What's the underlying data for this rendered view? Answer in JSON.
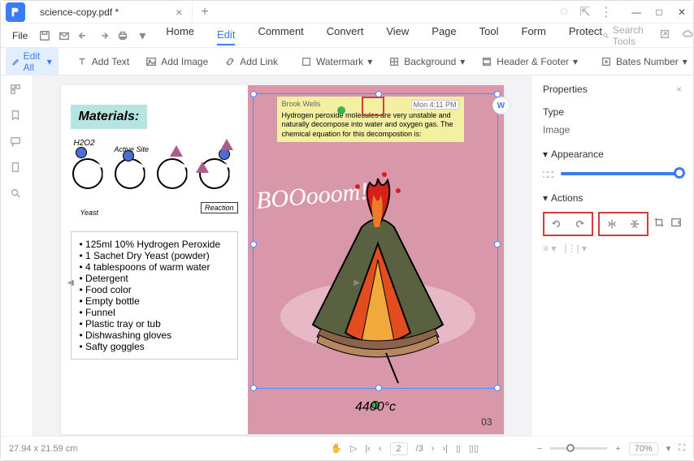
{
  "title_bar": {
    "tab_name": "science-copy.pdf *"
  },
  "menu": {
    "file": "File",
    "items": [
      "Home",
      "Edit",
      "Comment",
      "Convert",
      "View",
      "Page",
      "Tool",
      "Form",
      "Protect"
    ],
    "active_index": 1,
    "search_placeholder": "Search Tools"
  },
  "toolbar": {
    "edit_all": "Edit All",
    "add_text": "Add Text",
    "add_image": "Add Image",
    "add_link": "Add Link",
    "watermark": "Watermark",
    "background": "Background",
    "header_footer": "Header & Footer",
    "bates": "Bates Number"
  },
  "document": {
    "materials_title": "Materials:",
    "diagram_labels": {
      "h2o2": "H2O2",
      "active_site": "Active Site",
      "yeast": "Yeast",
      "reaction": "Reaction"
    },
    "materials_list": [
      "125ml 10% Hydrogen Peroxide",
      "1 Sachet Dry Yeast (powder)",
      "4 tablespoons of warm water",
      "Detergent",
      "Food color",
      "Empty bottle",
      "Funnel",
      "Plastic tray or tub",
      "Dishwashing gloves",
      "Safty goggles"
    ],
    "note": {
      "author": "Brook Wells",
      "time": "Mon 4:11 PM",
      "body": "Hydrogen peroxide molecules are very unstable and naturally decompose into water and oxygen gas. The chemical equation for this decompostion is:"
    },
    "boom": "BOOooom!",
    "temperature": "4400°c",
    "page_number": "03"
  },
  "properties": {
    "title": "Properties",
    "type_label": "Type",
    "type_value": "Image",
    "appearance_label": "Appearance",
    "actions_label": "Actions"
  },
  "status": {
    "dimensions": "27.94 x 21.59 cm",
    "page_current": "2",
    "page_total": "/3",
    "zoom": "70%"
  }
}
